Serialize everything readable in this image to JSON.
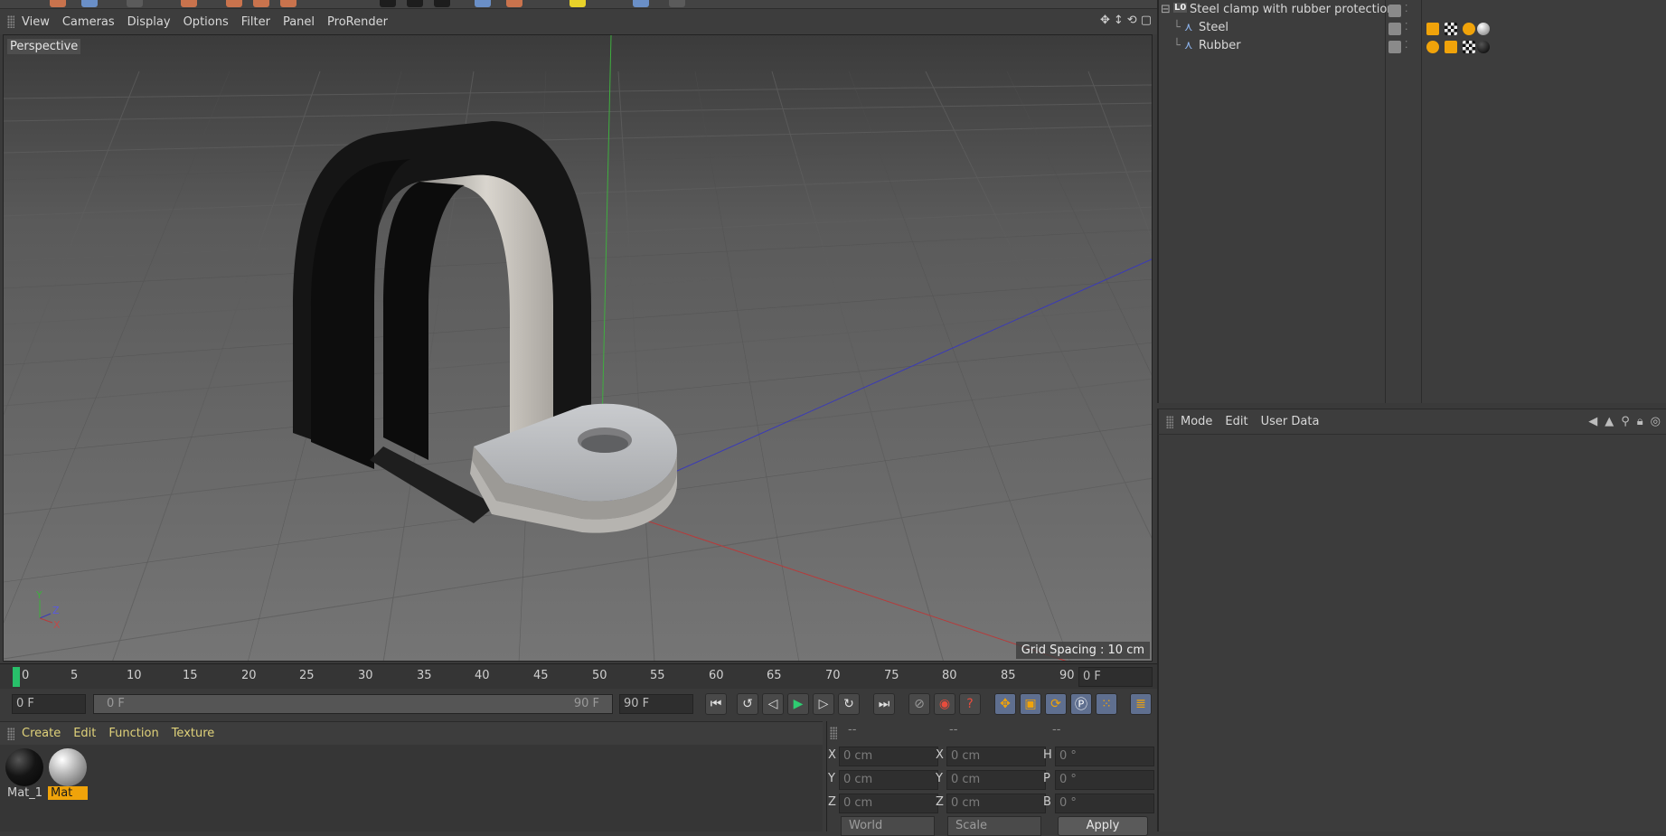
{
  "viewport_menu": [
    "View",
    "Cameras",
    "Display",
    "Options",
    "Filter",
    "Panel",
    "ProRender"
  ],
  "viewport": {
    "camera_label": "Perspective",
    "grid_spacing": "Grid Spacing : 10 cm",
    "axis_labels": {
      "y": "Y",
      "z": "Z",
      "x": "X"
    }
  },
  "timeline": {
    "ticks": [
      "0",
      "5",
      "10",
      "15",
      "20",
      "25",
      "30",
      "35",
      "40",
      "45",
      "50",
      "55",
      "60",
      "65",
      "70",
      "75",
      "80",
      "85",
      "90"
    ],
    "current_frame_field": "0 F"
  },
  "transport": {
    "start_field": "0 F",
    "range_start": "0 F",
    "range_end": "90 F",
    "end_field": "90 F"
  },
  "materials": {
    "menu": [
      "Create",
      "Edit",
      "Function",
      "Texture"
    ],
    "items": [
      {
        "label": "Mat_1",
        "selected": false,
        "color": "#111111"
      },
      {
        "label": "Mat",
        "selected": true,
        "color": "#bdbdbd"
      }
    ]
  },
  "coordinates": {
    "headers": [
      "--",
      "--",
      "--"
    ],
    "rows": [
      {
        "l1": "X",
        "v1": "0 cm",
        "l2": "X",
        "v2": "0 cm",
        "l3": "H",
        "v3": "0 °"
      },
      {
        "l1": "Y",
        "v1": "0 cm",
        "l2": "Y",
        "v2": "0 cm",
        "l3": "P",
        "v3": "0 °"
      },
      {
        "l1": "Z",
        "v1": "0 cm",
        "l2": "Z",
        "v2": "0 cm",
        "l3": "B",
        "v3": "0 °"
      }
    ],
    "world": "World",
    "scale": "Scale",
    "apply": "Apply"
  },
  "objects": {
    "root": "Steel clamp with rubber protection",
    "root_badge": "L0",
    "children": [
      "Steel",
      "Rubber"
    ]
  },
  "attributes": {
    "menu": [
      "Mode",
      "Edit",
      "User Data"
    ]
  },
  "colors": {
    "accent": "#f0a30a",
    "play_green": "#2ecc71",
    "y_axis": "#3fae3f",
    "x_axis": "#b83a3a",
    "z_axis": "#3a3ab8"
  }
}
